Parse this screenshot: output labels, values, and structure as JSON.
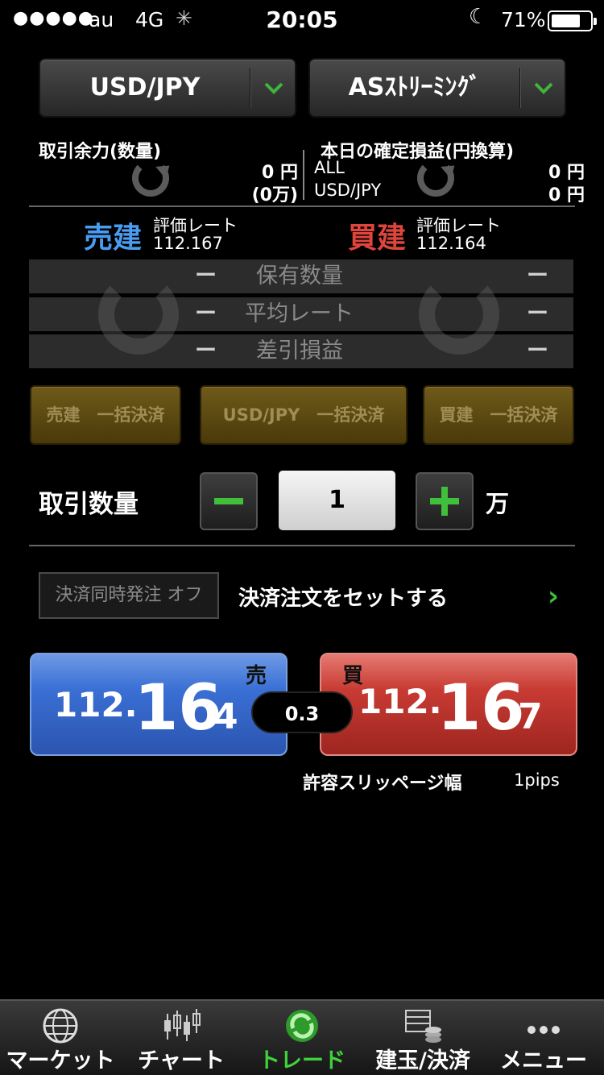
{
  "status_bar": {
    "signal": "●●●●●",
    "carrier": "au",
    "network": "4G",
    "time": "20:05",
    "battery_pct": "71%",
    "battery_level": 0.71
  },
  "selectors": {
    "pair": "USD/JPY",
    "mode": "ASｽﾄﾘｰﾐﾝｸﾞ"
  },
  "account": {
    "margin_title": "取引余力(数量)",
    "margin_value": "0 円",
    "margin_units": "(0万)",
    "pnl_title": "本日の確定損益(円換算)",
    "pnl_rows": [
      {
        "label": "ALL",
        "value": "0 円"
      },
      {
        "label": "USD/JPY",
        "value": "0 円"
      }
    ]
  },
  "rates": {
    "sell_label": "売建",
    "sell_sub": "評価レート",
    "sell_rate": "112.167",
    "buy_label": "買建",
    "buy_sub": "評価レート",
    "buy_rate": "112.164"
  },
  "positions": [
    {
      "label": "保有数量",
      "sell": "ー",
      "buy": "ー"
    },
    {
      "label": "平均レート",
      "sell": "ー",
      "buy": "ー"
    },
    {
      "label": "差引損益",
      "sell": "ー",
      "buy": "ー"
    }
  ],
  "bulk_buttons": {
    "sell": "売建　一括決済",
    "pair": "USD/JPY　一括決済",
    "buy": "買建　一括決済"
  },
  "quantity": {
    "label": "取引数量",
    "minus": "−",
    "value": "1",
    "plus": "+",
    "unit": "万"
  },
  "settlement": {
    "toggle": "決済同時発注 オフ",
    "link": "決済注文をセットする",
    "arrow": "›"
  },
  "prices": {
    "sell": {
      "side": "売",
      "p1": "112.",
      "p2": "16",
      "p3": "4"
    },
    "buy": {
      "side": "買",
      "p1": "112.",
      "p2": "16",
      "p3": "7"
    },
    "spread": "0.3",
    "slippage_label": "許容スリッページ幅",
    "slippage_value": "1pips"
  },
  "tabs": [
    {
      "label": "マーケット",
      "icon": "globe-icon"
    },
    {
      "label": "チャート",
      "icon": "candlestick-icon"
    },
    {
      "label": "トレード",
      "icon": "trade-icon",
      "active": true
    },
    {
      "label": "建玉/決済",
      "icon": "position-icon"
    },
    {
      "label": "メニュー",
      "icon": "menu-icon"
    }
  ],
  "colors": {
    "accent_green": "#3fbf3a",
    "sell_blue": "#3a6fd4",
    "buy_red": "#c83b33",
    "sell_label": "#4a9cf0",
    "buy_label": "#e0453c"
  }
}
